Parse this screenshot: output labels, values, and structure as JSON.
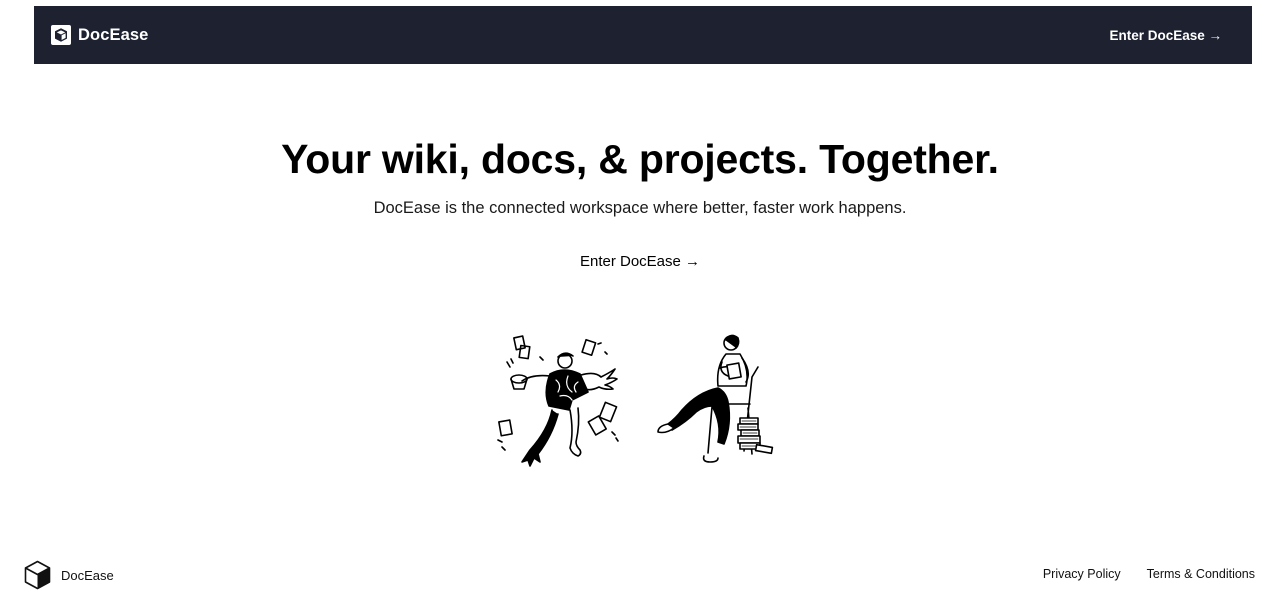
{
  "navbar": {
    "brand_name": "DocEase",
    "logo_icon": "cube-icon",
    "cta_label": "Enter DocEase →"
  },
  "hero": {
    "title": "Your wiki, docs, & projects. Together.",
    "subtitle": "DocEase is the connected workspace where better, faster work happens.",
    "cta_label": "Enter DocEase →"
  },
  "illustrations": {
    "left": "person-juggling-papers-illustration",
    "right": "person-reading-on-chair-illustration"
  },
  "footer": {
    "brand_name": "DocEase",
    "logo_icon": "cube-icon",
    "links": [
      {
        "label": "Privacy Policy"
      },
      {
        "label": "Terms & Conditions"
      }
    ]
  },
  "colors": {
    "navbar_bg": "#1e2230",
    "text": "#111111",
    "background": "#ffffff"
  }
}
